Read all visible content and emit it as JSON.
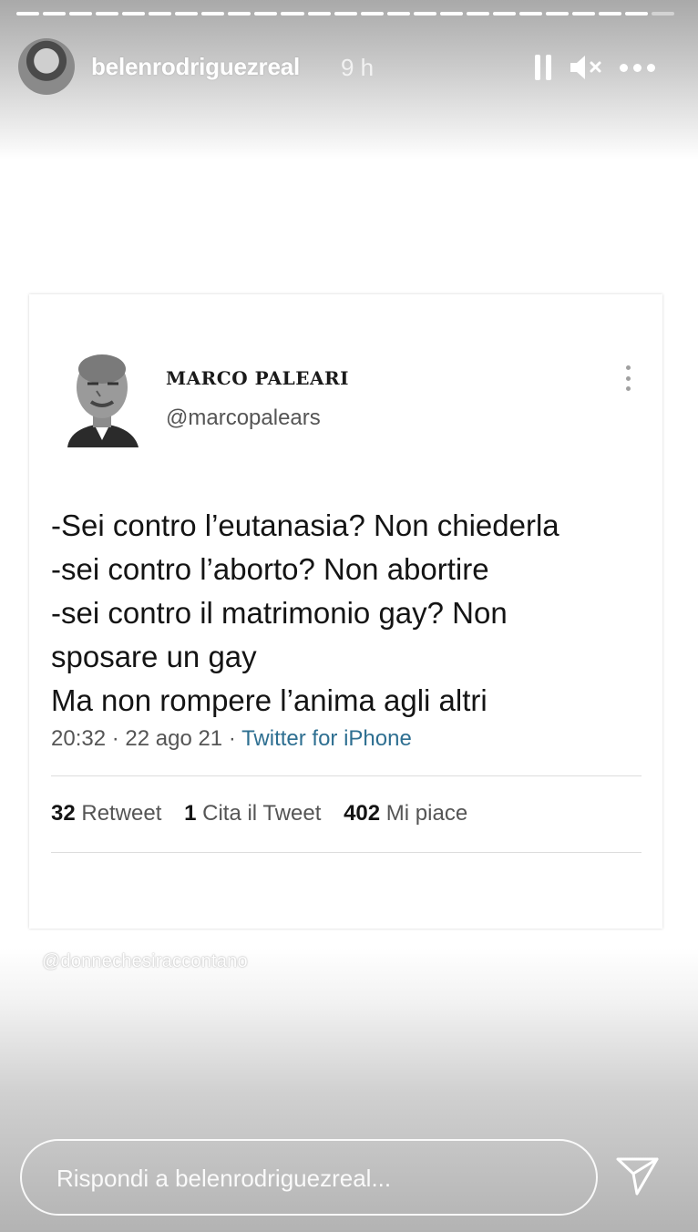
{
  "story": {
    "progress_segments": 25,
    "header": {
      "username": "belenrodriguezreal",
      "time": "9 h",
      "icons": [
        "pause-icon",
        "mute-icon",
        "more-icon"
      ]
    },
    "watermark": "@donnechesiraccontano",
    "reply": {
      "placeholder": "Rispondi a belenrodriguezreal...",
      "send_icon": "send-icon"
    }
  },
  "tweet": {
    "author_name": "MARCO PALEARI",
    "author_handle": "@marcopalears",
    "text_lines": [
      "-Sei contro l’eutanasia? Non chiederla",
      "-sei contro l’aborto? Non abortire",
      "-sei contro il matrimonio gay? Non",
      "sposare un gay",
      "Ma non rompere l’anima agli altri"
    ],
    "timestamp": "20:32 · 22 ago 21 · ",
    "source": "Twitter for iPhone",
    "stats": {
      "retweets_count": "32",
      "retweets_label": "Retweet",
      "quotes_count": "1",
      "quotes_label": "Cita il Tweet",
      "likes_count": "402",
      "likes_label": "Mi piace"
    }
  },
  "colors": {
    "tweet_source_link": "#2e6f91",
    "text_dark": "#141414",
    "text_muted": "#555555"
  }
}
